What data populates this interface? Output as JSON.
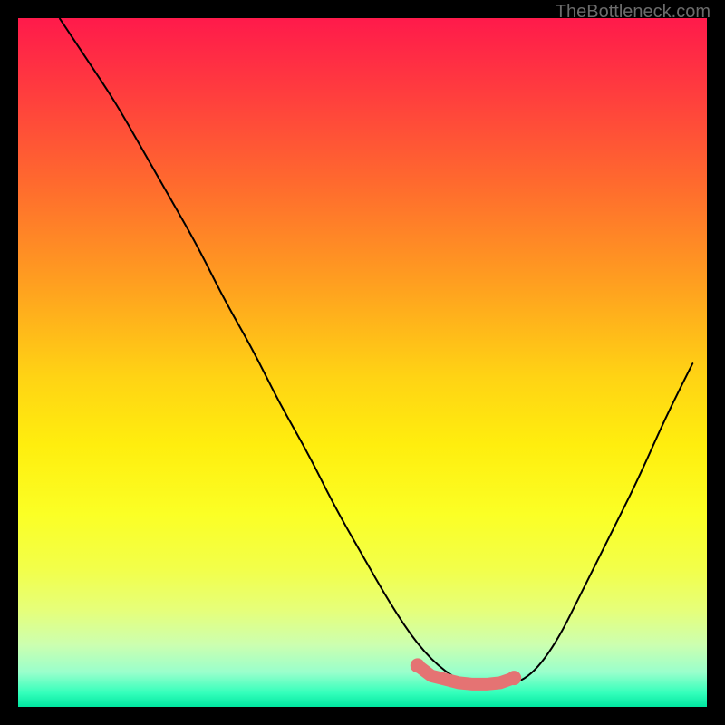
{
  "attribution": "TheBottleneck.com",
  "colors": {
    "background": "#000000",
    "curve": "#000000",
    "highlight": "#e57373",
    "gradient_top": "#ff1a4b",
    "gradient_bottom": "#00e6a0"
  },
  "chart_data": {
    "type": "line",
    "title": "",
    "xlabel": "",
    "ylabel": "",
    "xlim": [
      0,
      100
    ],
    "ylim": [
      0,
      100
    ],
    "grid": false,
    "legend": false,
    "series": [
      {
        "name": "bottleneck-curve",
        "x": [
          6,
          10,
          14,
          18,
          22,
          26,
          30,
          34,
          38,
          42,
          46,
          50,
          54,
          58,
          62,
          66,
          70,
          74,
          78,
          82,
          86,
          90,
          94,
          98
        ],
        "y": [
          100,
          94,
          88,
          81,
          74,
          67,
          59,
          52,
          44,
          37,
          29,
          22,
          15,
          9,
          5,
          3,
          3,
          4,
          9,
          17,
          25,
          33,
          42,
          50
        ]
      }
    ],
    "highlight_segment": {
      "name": "optimal-range",
      "x": [
        58,
        60,
        62,
        64,
        66,
        68,
        70,
        72
      ],
      "y": [
        6.0,
        4.5,
        4.0,
        3.5,
        3.3,
        3.3,
        3.5,
        4.2
      ]
    }
  }
}
